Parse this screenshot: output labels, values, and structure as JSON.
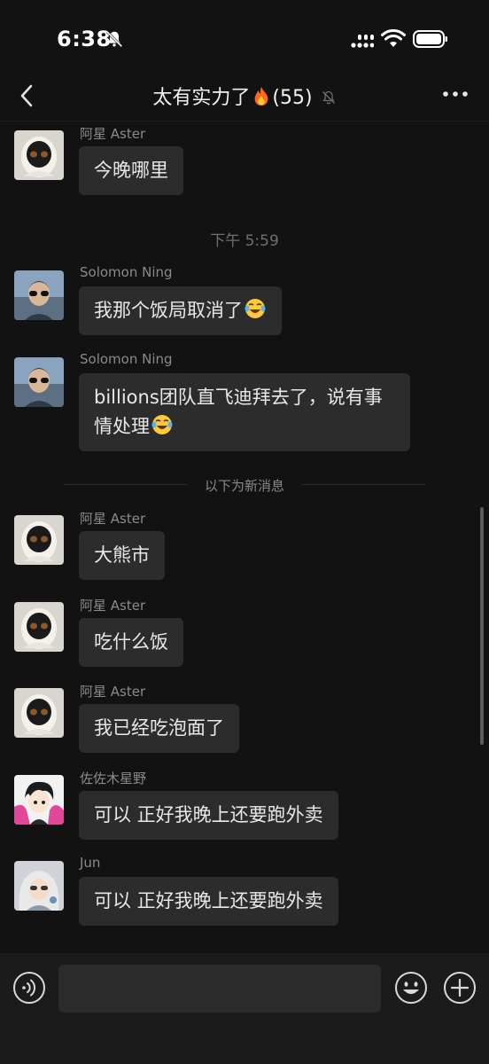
{
  "status": {
    "time": "6:38"
  },
  "header": {
    "title": "太有实力了",
    "count": "(55)"
  },
  "messages": [
    {
      "sender": "阿星 Aster",
      "text": "今晚哪里"
    },
    {
      "sender": "Solomon Ning",
      "text": "我那个饭局取消了"
    },
    {
      "sender": "Solomon Ning",
      "text": "billions团队直飞迪拜去了，说有事情处理"
    },
    {
      "sender": "阿星 Aster",
      "text": "大熊市"
    },
    {
      "sender": "阿星 Aster",
      "text": "吃什么饭"
    },
    {
      "sender": "阿星 Aster",
      "text": "我已经吃泡面了"
    },
    {
      "sender": "佐佐木星野",
      "text": "可以 正好我晚上还要跑外卖"
    },
    {
      "sender": "Jun",
      "text": "可以 正好我晚上还要跑外卖"
    }
  ],
  "timestamp": "下午 5:59",
  "new_messages_label": "以下为新消息",
  "input": {
    "value": ""
  },
  "icons": {
    "back": "chevron-left-icon",
    "mute": "bell-off-icon",
    "fire": "fire-emoji",
    "more": "ellipsis-icon",
    "voice": "voice-icon",
    "emoji": "smiley-icon",
    "plus": "plus-icon",
    "laugh": "tears-of-joy-emoji"
  }
}
